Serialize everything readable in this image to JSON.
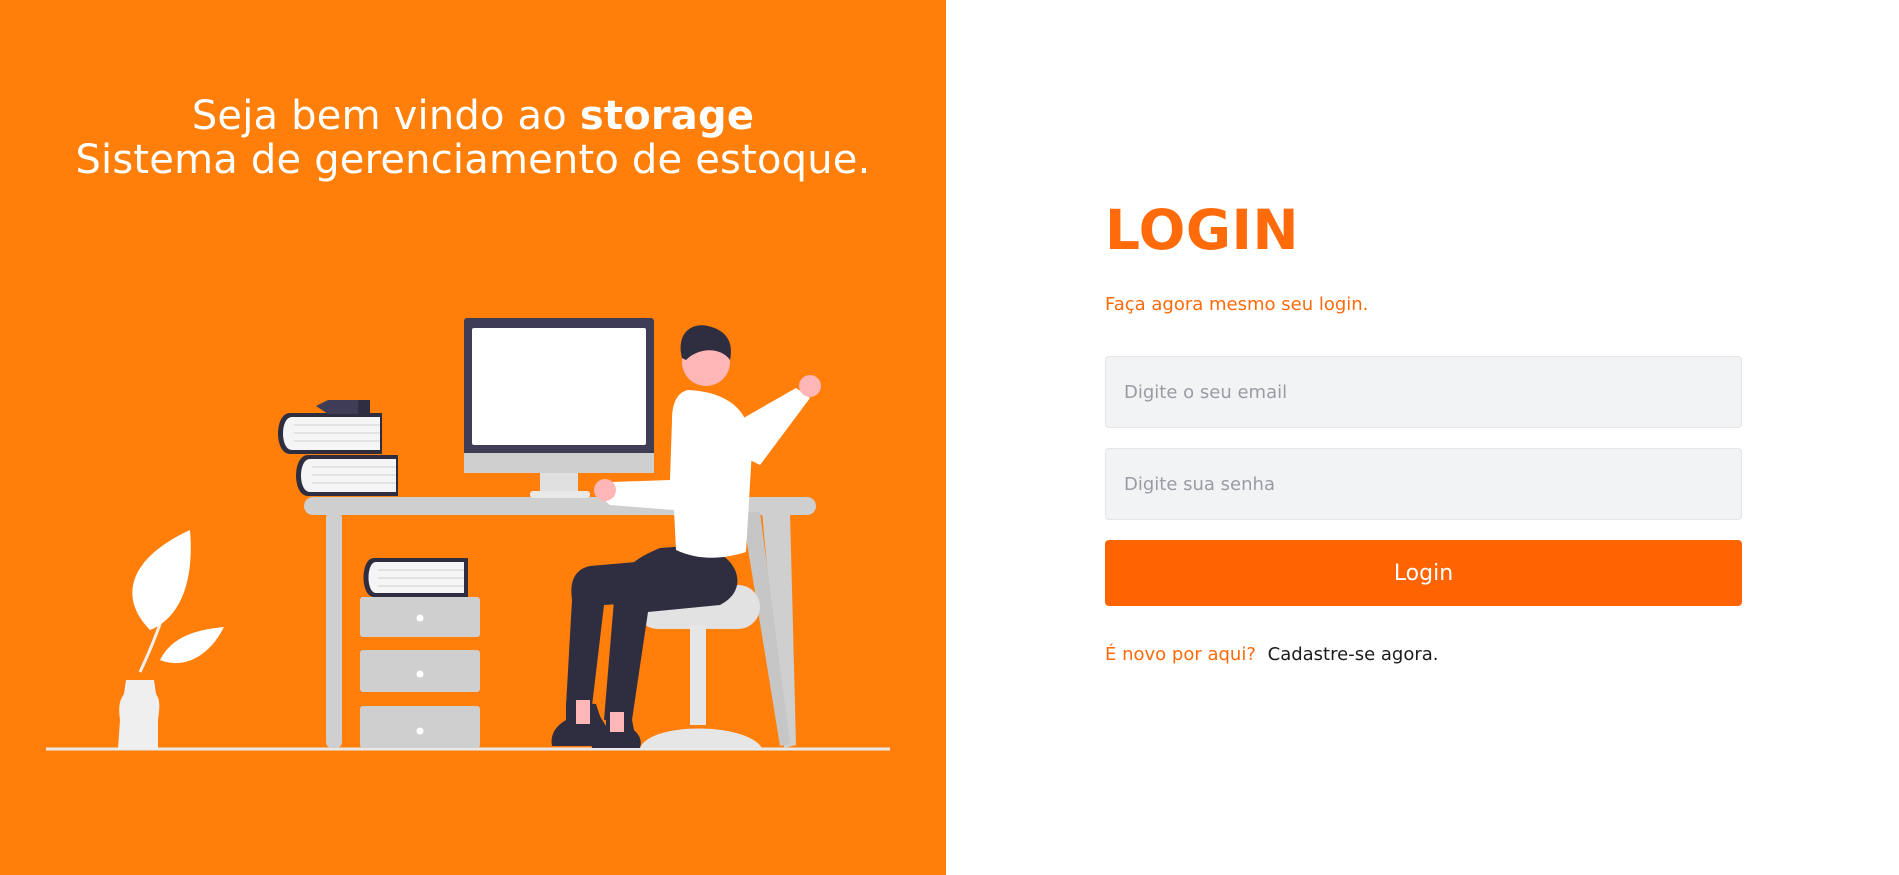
{
  "welcome": {
    "line1_prefix": "Seja bem vindo ao ",
    "brand": "storage",
    "line2": "Sistema de gerenciamento de estoque."
  },
  "login": {
    "title": "LOGIN",
    "subtitle": "Faça agora mesmo seu login.",
    "email_placeholder": "Digite o seu email",
    "email_value": "",
    "password_placeholder": "Digite sua senha",
    "password_value": "",
    "button_label": "Login",
    "signup_question": "É novo por aqui?",
    "signup_link": "Cadastre-se agora."
  },
  "colors": {
    "left_panel_bg": "#ff7f0a",
    "accent": "#ff6a0a",
    "button_bg": "#ff6302",
    "input_bg": "#f2f3f5",
    "link_text": "#1b1b1b"
  },
  "illustration": {
    "icons": [
      "plant-icon",
      "books-icon",
      "computer-monitor-icon",
      "desk-icon",
      "drawer-cabinet-icon",
      "person-icon",
      "stool-icon"
    ]
  }
}
